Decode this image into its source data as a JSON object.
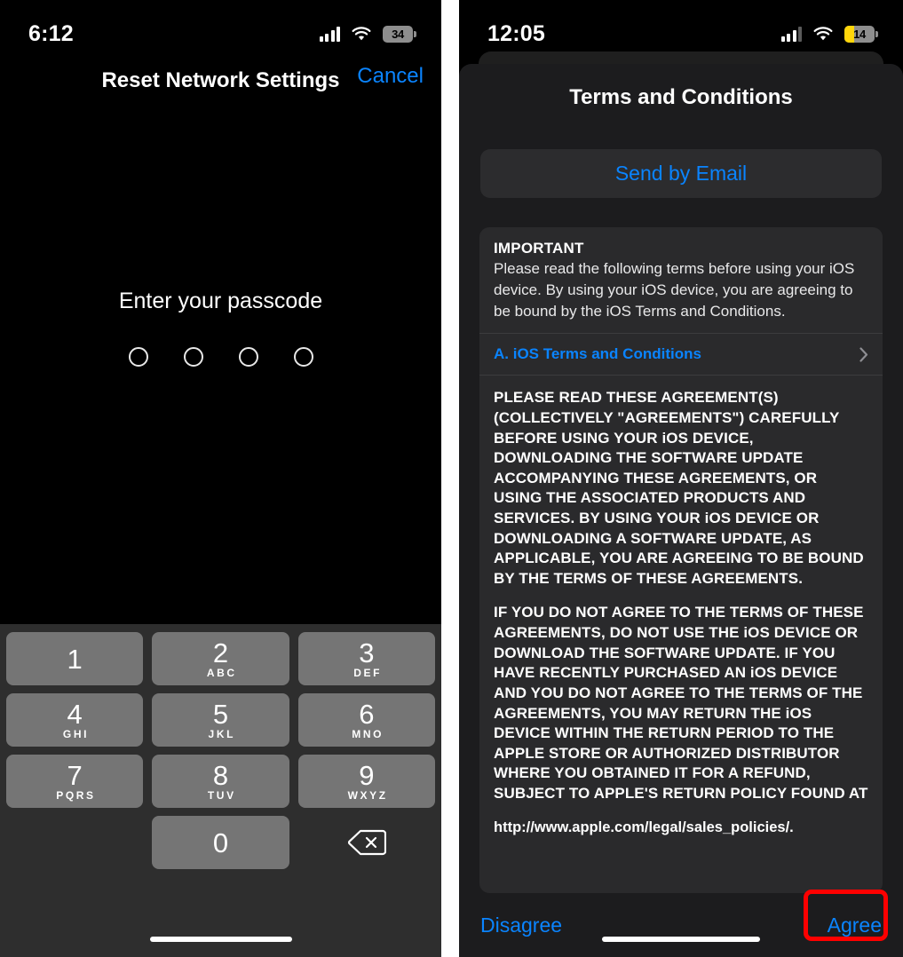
{
  "left_phone": {
    "status_bar": {
      "time": "6:12",
      "signal_icon": "cellular-signal-icon",
      "wifi_icon": "wifi-icon",
      "battery_icon": "battery-icon",
      "battery_level": "34",
      "battery_color": "#8e8e8e"
    },
    "nav": {
      "title": "Reset Network Settings",
      "cancel_label": "Cancel",
      "accent": "#0a84ff"
    },
    "passcode": {
      "prompt": "Enter your passcode",
      "digits_entered": 0,
      "digit_count": 4
    },
    "keypad": {
      "rows": [
        [
          {
            "num": "1",
            "letters": ""
          },
          {
            "num": "2",
            "letters": "ABC"
          },
          {
            "num": "3",
            "letters": "DEF"
          }
        ],
        [
          {
            "num": "4",
            "letters": "GHI"
          },
          {
            "num": "5",
            "letters": "JKL"
          },
          {
            "num": "6",
            "letters": "MNO"
          }
        ],
        [
          {
            "num": "7",
            "letters": "PQRS"
          },
          {
            "num": "8",
            "letters": "TUV"
          },
          {
            "num": "9",
            "letters": "WXYZ"
          }
        ]
      ],
      "zero": {
        "num": "0",
        "letters": ""
      },
      "delete_icon": "backspace-delete-icon"
    }
  },
  "right_phone": {
    "status_bar": {
      "time": "12:05",
      "signal_icon": "cellular-signal-icon",
      "wifi_icon": "wifi-icon",
      "battery_icon": "battery-icon",
      "battery_level": "14",
      "battery_color": "#ffd60a"
    },
    "sheet": {
      "title": "Terms and Conditions",
      "send_by_email_label": "Send by Email",
      "important_heading": "IMPORTANT",
      "important_body": "Please read the following terms before using your iOS device. By using your iOS device, you are agreeing to be bound by the iOS Terms and Conditions.",
      "terms_link_label": "A. iOS Terms and Conditions",
      "chevron_icon": "chevron-right-icon",
      "legal_paragraphs": [
        "PLEASE READ THESE AGREEMENT(S) (COLLECTIVELY \"AGREEMENTS\") CAREFULLY BEFORE USING YOUR iOS DEVICE, DOWNLOADING THE SOFTWARE UPDATE ACCOMPANYING THESE AGREEMENTS, OR USING THE ASSOCIATED PRODUCTS AND SERVICES. BY USING YOUR iOS DEVICE OR DOWNLOADING A SOFTWARE UPDATE, AS APPLICABLE, YOU ARE AGREEING TO BE BOUND BY THE TERMS OF THESE AGREEMENTS.",
        "IF YOU DO NOT AGREE TO THE TERMS OF THESE AGREEMENTS, DO NOT USE THE iOS DEVICE OR DOWNLOAD THE SOFTWARE UPDATE. IF YOU HAVE RECENTLY PURCHASED AN iOS DEVICE AND YOU DO NOT AGREE TO THE TERMS OF THE AGREEMENTS, YOU MAY RETURN THE iOS DEVICE WITHIN THE RETURN PERIOD TO THE APPLE STORE OR AUTHORIZED DISTRIBUTOR WHERE YOU OBTAINED IT FOR A REFUND, SUBJECT TO APPLE'S RETURN POLICY FOUND AT"
      ],
      "legal_url": "http://www.apple.com/legal/sales_policies/.",
      "disagree_label": "Disagree",
      "agree_label": "Agree",
      "accent": "#0a84ff",
      "highlight_color": "#fe0000"
    }
  }
}
